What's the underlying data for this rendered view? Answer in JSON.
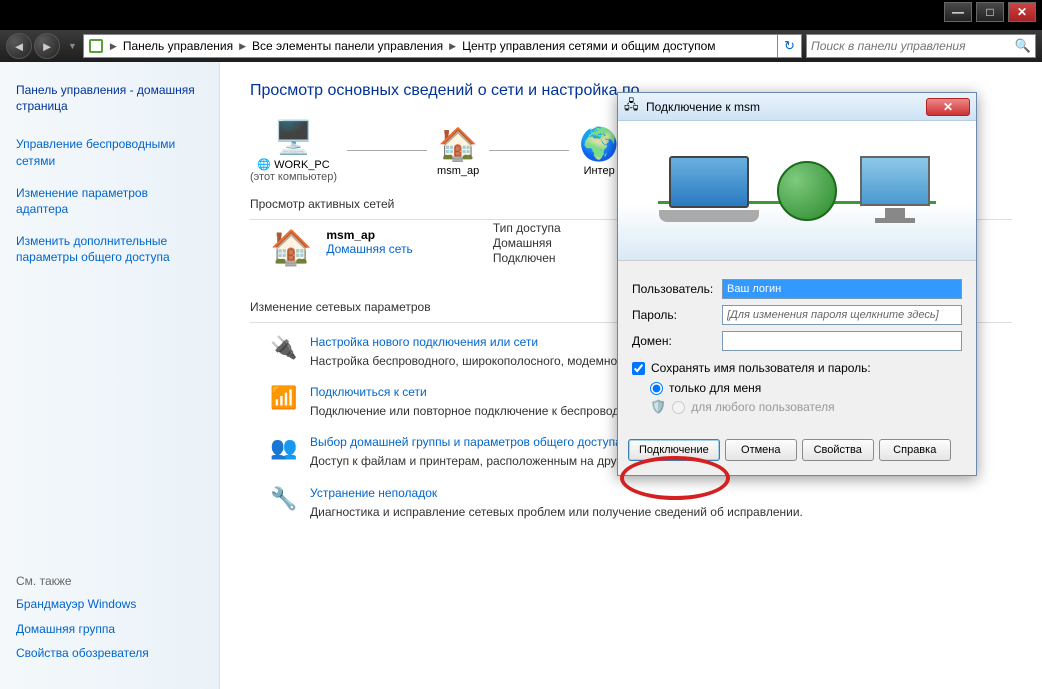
{
  "window": {
    "title_controls": {
      "min": "—",
      "max": "□",
      "close": "✕"
    }
  },
  "toolbar": {
    "breadcrumb": [
      "Панель управления",
      "Все элементы панели управления",
      "Центр управления сетями и общим доступом"
    ],
    "search_placeholder": "Поиск в панели управления"
  },
  "sidebar": {
    "heading": "Панель управления - домашняя страница",
    "links": [
      "Управление беспроводными сетями",
      "Изменение параметров адаптера",
      "Изменить дополнительные параметры общего доступа"
    ],
    "footer_title": "См. также",
    "footer_links": [
      "Брандмауэр Windows",
      "Домашняя группа",
      "Свойства обозревателя"
    ]
  },
  "main": {
    "heading": "Просмотр основных сведений о сети и настройка по",
    "nodes": [
      {
        "name": "WORK_PC",
        "sub": "(этот компьютер)"
      },
      {
        "name": "msm_ap",
        "sub": ""
      },
      {
        "name": "Интер",
        "sub": ""
      }
    ],
    "active_title": "Просмотр активных сетей",
    "active_net": {
      "name": "msm_ap",
      "link": "Домашняя сеть"
    },
    "props": [
      "Тип доступа",
      "Домашняя",
      "Подключен"
    ],
    "change_title": "Изменение сетевых параметров",
    "tasks": [
      {
        "title": "Настройка нового подключения или сети",
        "desc": "Настройка беспроводного, широкополосного, модемного или же настройка маршрутизатора или точки доступа."
      },
      {
        "title": "Подключиться к сети",
        "desc": "Подключение или повторное подключение к беспроводному сетевому соединению или подключение к VPN."
      },
      {
        "title": "Выбор домашней группы и параметров общего доступа",
        "desc": "Доступ к файлам и принтерам, расположенным на других изменение параметров общего доступа."
      },
      {
        "title": "Устранение неполадок",
        "desc": "Диагностика и исправление сетевых проблем или получение сведений об исправлении."
      }
    ]
  },
  "dialog": {
    "title": "Подключение к msm",
    "labels": {
      "user": "Пользователь:",
      "password": "Пароль:",
      "domain": "Домен:"
    },
    "user_value": "Ваш логин",
    "password_hint": "[Для изменения пароля щелкните здесь]",
    "save_label": "Сохранять имя пользователя и пароль:",
    "radio_me": "только для меня",
    "radio_all": "для любого пользователя",
    "buttons": {
      "connect": "Подключение",
      "cancel": "Отмена",
      "props": "Свойства",
      "help": "Справка"
    }
  }
}
